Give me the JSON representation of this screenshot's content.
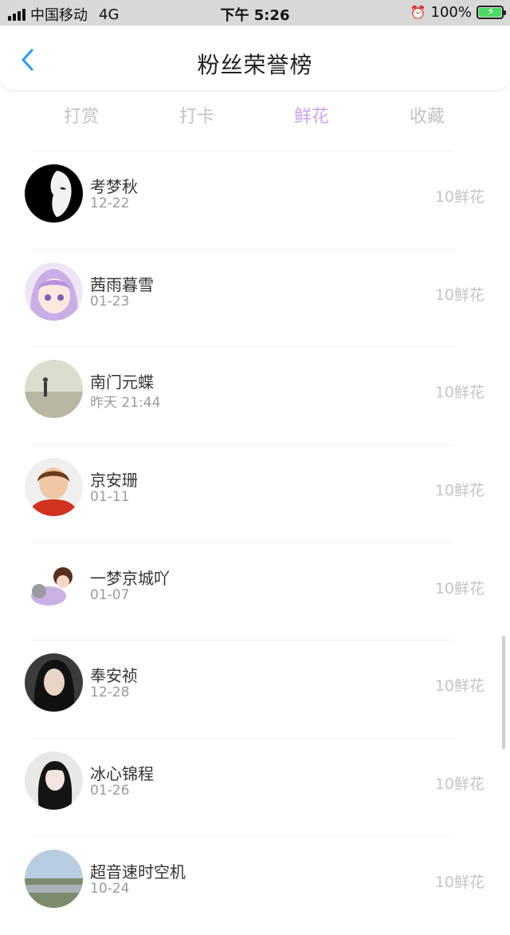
{
  "status_bar": {
    "carrier": "中国移动",
    "network": "4G",
    "time": "下午 5:26",
    "battery": "100%"
  },
  "nav": {
    "title": "粉丝荣誉榜",
    "back_icon": "chevron-left-icon"
  },
  "tabs": [
    {
      "label": "打赏",
      "active": false
    },
    {
      "label": "打卡",
      "active": false
    },
    {
      "label": "鲜花",
      "active": true
    },
    {
      "label": "收藏",
      "active": false
    }
  ],
  "fans": [
    {
      "name": "考梦秋",
      "date": "12-22",
      "amount": "10鲜花"
    },
    {
      "name": "茜雨暮雪",
      "date": "01-23",
      "amount": "10鲜花"
    },
    {
      "name": "南门元蝶",
      "date": "昨天 21:44",
      "amount": "10鲜花"
    },
    {
      "name": "京安珊",
      "date": "01-11",
      "amount": "10鲜花"
    },
    {
      "name": "一梦京城吖",
      "date": "01-07",
      "amount": "10鲜花"
    },
    {
      "name": "奉安祯",
      "date": "12-28",
      "amount": "10鲜花"
    },
    {
      "name": "冰心锦程",
      "date": "01-26",
      "amount": "10鲜花"
    },
    {
      "name": "超音速时空机",
      "date": "10-24",
      "amount": "10鲜花"
    }
  ],
  "colors": {
    "active_tab": "#c9a6ea",
    "inactive_tab": "#c3c3c3",
    "back_icon": "#2b9af3",
    "battery": "#4cd964"
  }
}
